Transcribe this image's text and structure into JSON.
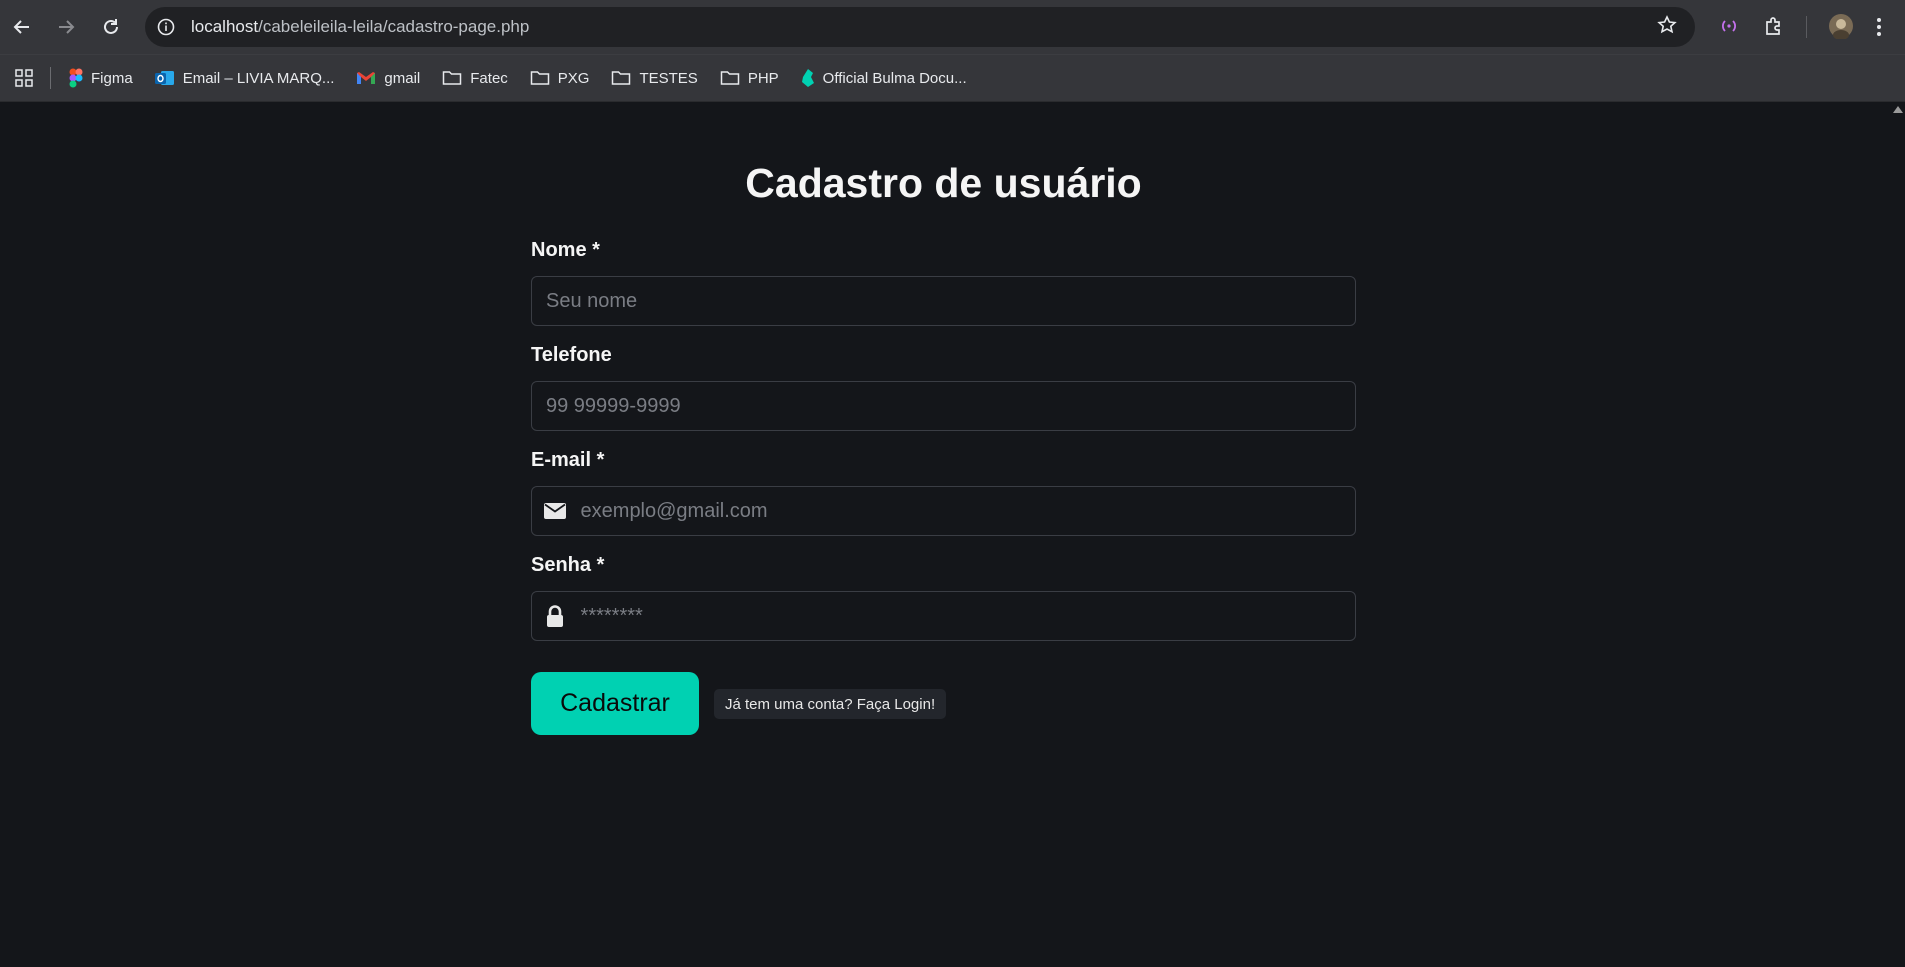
{
  "browser": {
    "url_host": "localhost",
    "url_path": "/cabeleileila-leila/cadastro-page.php",
    "bookmarks": [
      {
        "label": "Figma",
        "icon": "figma-icon"
      },
      {
        "label": "Email – LIVIA MARQ...",
        "icon": "outlook-icon"
      },
      {
        "label": "gmail",
        "icon": "gmail-icon"
      },
      {
        "label": "Fatec",
        "icon": "folder-icon"
      },
      {
        "label": "PXG",
        "icon": "folder-icon"
      },
      {
        "label": "TESTES",
        "icon": "folder-icon"
      },
      {
        "label": "PHP",
        "icon": "folder-icon"
      },
      {
        "label": "Official Bulma Docu...",
        "icon": "bulma-icon"
      }
    ]
  },
  "form": {
    "title": "Cadastro de usuário",
    "nome_label": "Nome *",
    "nome_placeholder": "Seu nome",
    "telefone_label": "Telefone",
    "telefone_placeholder": "99 99999-9999",
    "email_label": "E-mail *",
    "email_placeholder": "exemplo@gmail.com",
    "senha_label": "Senha *",
    "senha_placeholder": "********",
    "submit_label": "Cadastrar",
    "login_link": "Já tem uma conta? Faça Login!"
  },
  "colors": {
    "page_bg": "#14161a",
    "primary": "#00d1b2",
    "chrome_bg": "#35363a"
  }
}
